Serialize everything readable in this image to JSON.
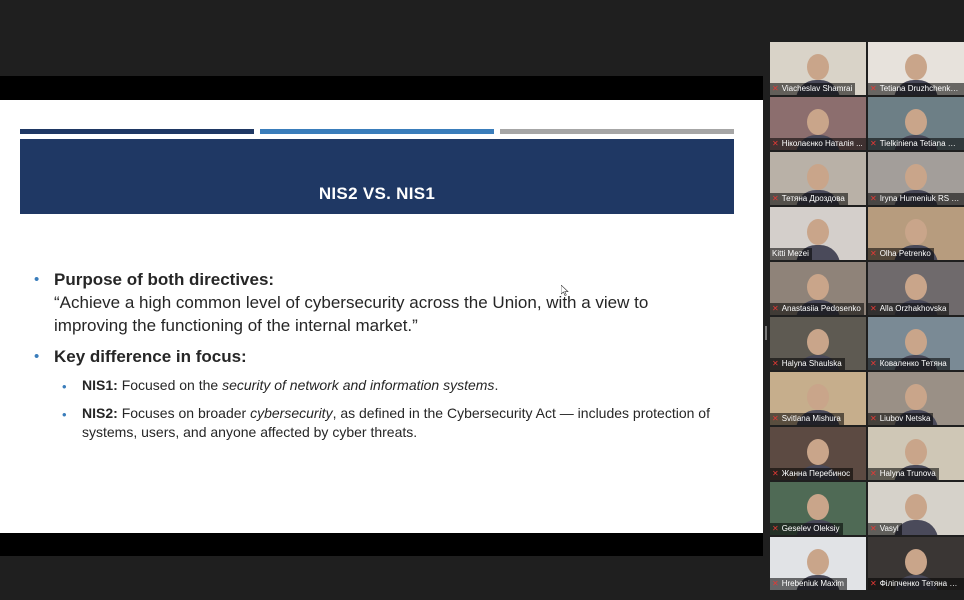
{
  "slide": {
    "title": "NIS2 VS. NIS1",
    "point1_heading": "Purpose of both directives:",
    "point1_quote": "“Achieve a high common level of cybersecurity across the Union, with a view to improving the functioning of the internal market.”",
    "point2_heading": "Key difference in focus:",
    "nis1_label": "NIS1:",
    "nis1_text_a": "Focused on the ",
    "nis1_text_italic": "security of network and information systems",
    "nis1_text_b": ".",
    "nis2_label": "NIS2:",
    "nis2_text_a": "Focuses on broader ",
    "nis2_text_italic": "cybersecurity",
    "nis2_text_b": ", as defined in the Cybersecurity Act — includes protection of systems, users, and anyone affected by cyber threats."
  },
  "participants": [
    {
      "name": "Viacheslav Shamrai",
      "muted": true,
      "bg": "#d9d3c8"
    },
    {
      "name": "Tetiana Druzhchenko...",
      "muted": true,
      "bg": "#e7e2dc"
    },
    {
      "name": "Ніколаєнко Наталія ...",
      "muted": true,
      "bg": "#8c6e6e"
    },
    {
      "name": "Tielkiniena Tetiana Re...",
      "muted": true,
      "bg": "#6d7f86"
    },
    {
      "name": "Тетяна Дроздова",
      "muted": true,
      "bg": "#b9b1a7"
    },
    {
      "name": "Iryna Humeniuk RS V...",
      "muted": true,
      "bg": "#a39e9a"
    },
    {
      "name": "Kitti Mezei",
      "muted": false,
      "active": true,
      "bg": "#d4cfcb"
    },
    {
      "name": "Olha Petrenko",
      "muted": true,
      "bg": "#b79c7e"
    },
    {
      "name": "Anastasiia Pedosenko",
      "muted": true,
      "bg": "#8f8379"
    },
    {
      "name": "Alla Orzhakhovska",
      "muted": true,
      "bg": "#6f6a6c"
    },
    {
      "name": "Halyna Shaulska",
      "muted": true,
      "bg": "#5e5a52"
    },
    {
      "name": "Коваленко Тетяна",
      "muted": true,
      "bg": "#7a8a95"
    },
    {
      "name": "Svitlana Mishura",
      "muted": true,
      "bg": "#c6ae8c"
    },
    {
      "name": "Liubov Netska",
      "muted": true,
      "bg": "#9a9086"
    },
    {
      "name": "Жанна Перебинос",
      "muted": true,
      "bg": "#5c4a42"
    },
    {
      "name": "Halyna Trunova",
      "muted": true,
      "bg": "#cfc7b6"
    },
    {
      "name": "Geselev Oleksiy",
      "muted": true,
      "bg": "#4f6a55"
    },
    {
      "name": "Vasyl",
      "muted": true,
      "bg": "#d6d2ca"
    },
    {
      "name": "Hrebeniuk Maxim",
      "muted": true,
      "bg": "#e1e3e6"
    },
    {
      "name": "Філіпченко Тетяна ВРУ",
      "muted": true,
      "bg": "#3a3634"
    }
  ],
  "icons": {
    "muted": "mic-muted-icon",
    "cursor": "mouse-cursor-icon"
  },
  "colors": {
    "title_band": "#1f3864",
    "accent": "#3a7dbb",
    "active_speaker": "#2ecc71"
  }
}
